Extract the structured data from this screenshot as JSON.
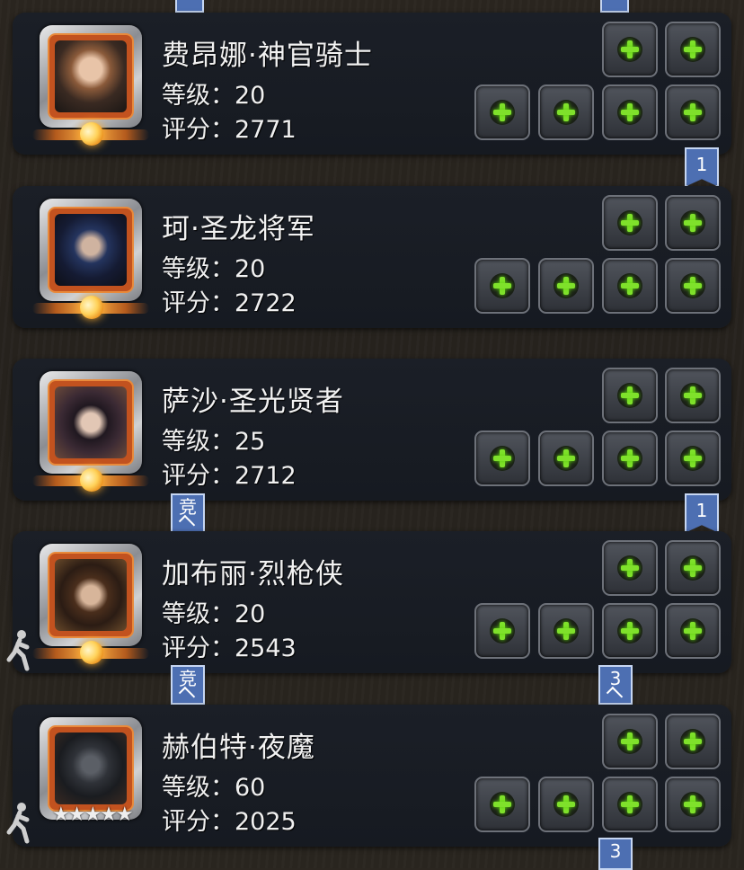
{
  "colors": {
    "accent_green": "#7fe12b",
    "ribbon_blue": "#4d6fb2",
    "portrait_orange": "#c2521f"
  },
  "labels": {
    "level": "等级：",
    "score": "评分："
  },
  "heroes": [
    {
      "name": "费昂娜·神官骑士",
      "level": "20",
      "score": "2771"
    },
    {
      "name": "珂·圣龙将军",
      "level": "20",
      "score": "2722"
    },
    {
      "name": "萨沙·圣光贤者",
      "level": "25",
      "score": "2712"
    },
    {
      "name": "加布丽·烈枪侠",
      "level": "20",
      "score": "2543"
    },
    {
      "name": "赫伯特·夜魔",
      "level": "60",
      "score": "2025"
    }
  ],
  "badges": {
    "b1": "1",
    "b2": "1",
    "b3": "3",
    "b4": "3",
    "comp1": "竞",
    "comp2": "竞"
  },
  "stars": {
    "hero5": "★★★★★",
    "count": 5
  }
}
